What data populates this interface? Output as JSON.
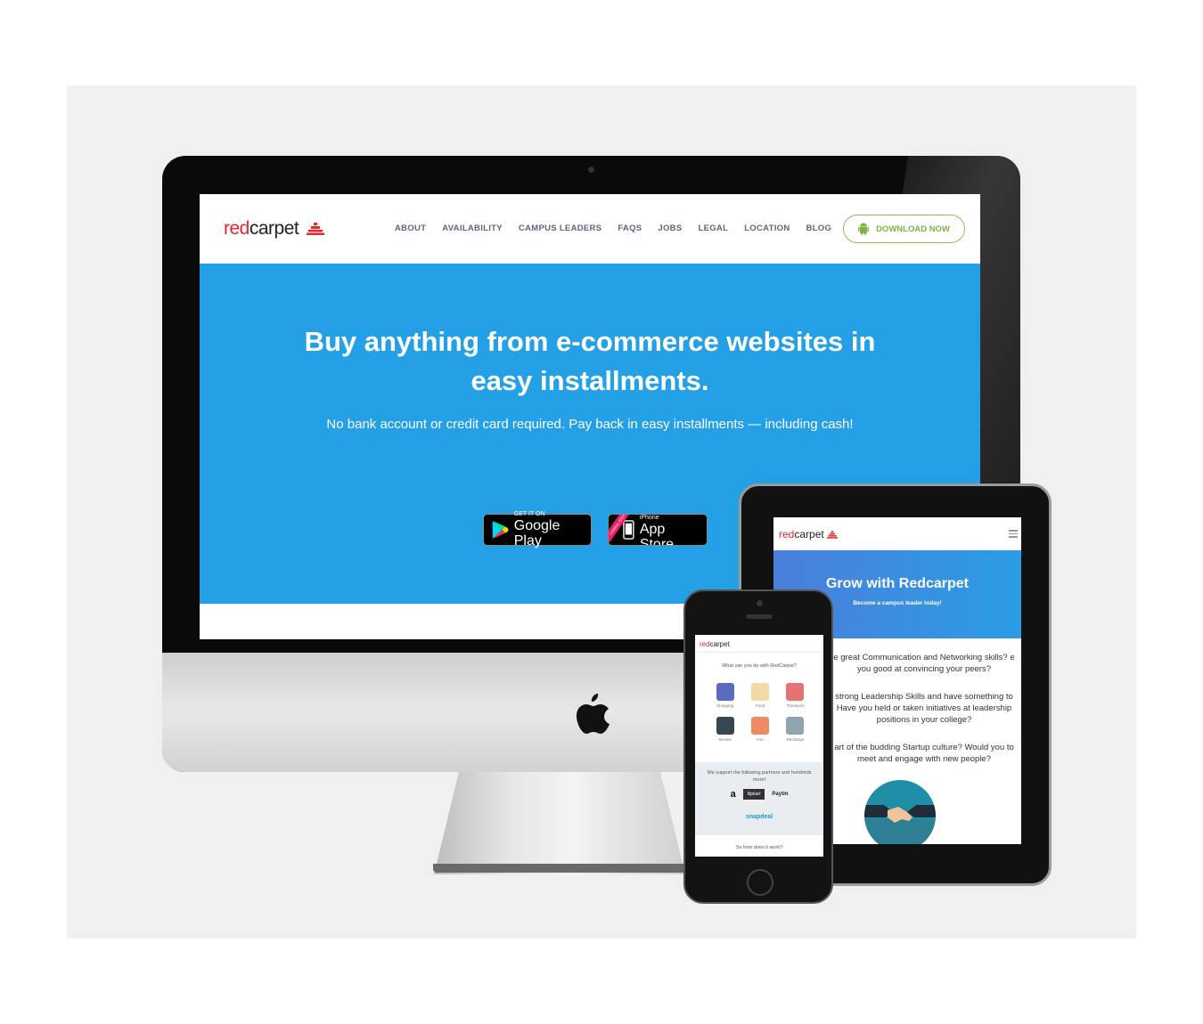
{
  "desktop": {
    "logo_red": "red",
    "logo_dark": "carpet",
    "nav": [
      "ABOUT",
      "AVAILABILITY",
      "CAMPUS LEADERS",
      "FAQS",
      "JOBS",
      "LEGAL",
      "LOCATION",
      "BLOG"
    ],
    "download_label": "DOWNLOAD NOW",
    "hero_title": "Buy anything from e-commerce websites in easy installments.",
    "hero_sub": "No bank account or credit card required. Pay back in easy installments — including cash!",
    "google_small": "GET IT ON",
    "google_big": "Google Play",
    "apple_small": "Available on the iPhone",
    "apple_big": "App Store",
    "apple_ribbon": "COMING SOON"
  },
  "tablet": {
    "logo_red": "red",
    "logo_dark": "carpet",
    "hero_title": "Grow with Redcarpet",
    "hero_sub": "Become a campus leader today!",
    "q1": "e great Communication and Networking skills? e you good at convincing your peers?",
    "q2": "strong Leadership Skills and have something to Have you held or taken initiatives at leadership positions in your college?",
    "q3": "art of the budding Startup culture? Would you to meet and engage with new people?"
  },
  "phone": {
    "logo_red": "red",
    "logo_dark": "carpet",
    "question": "What can you do with RedCarpet?",
    "categories": [
      "Shopping",
      "Food",
      "Transport",
      "Movies",
      "Fun",
      "Recharge"
    ],
    "partners_text": "We support the following partners and hundreds more!",
    "partner_amazon": "a",
    "partner_flipkart": "flipkart",
    "partner_paytm": "Paytm",
    "partner_snapdeal": "snapdeal",
    "how_text": "So how does it work?"
  },
  "colors": {
    "brand_red": "#e4272d",
    "hero_blue": "#24a0e6",
    "download_green": "#7cb342"
  }
}
